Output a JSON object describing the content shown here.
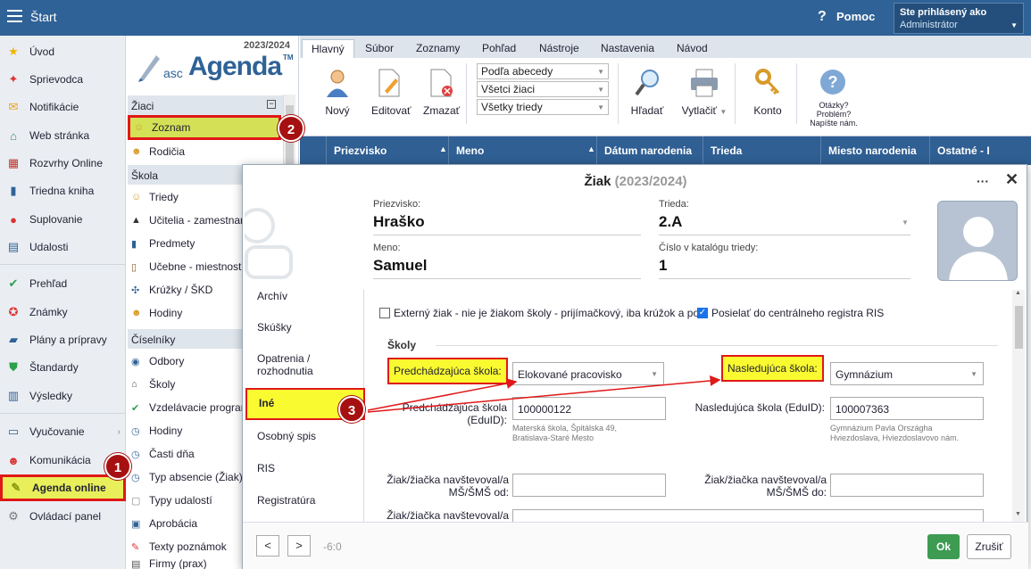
{
  "topbar": {
    "start_label": "Štart",
    "help_label": "Pomoc",
    "logged_in_label": "Ste prihlásený ako",
    "user_role": "Administrátor"
  },
  "leftnav": {
    "items": [
      {
        "label": "Úvod",
        "icon": "star-icon"
      },
      {
        "label": "Sprievodca",
        "icon": "wand-icon"
      },
      {
        "label": "Notifikácie",
        "icon": "envelope-icon"
      },
      {
        "label": "Web stránka",
        "icon": "home-icon"
      },
      {
        "label": "Rozvrhy Online",
        "icon": "calendar-icon"
      },
      {
        "label": "Triedna kniha",
        "icon": "book-icon"
      },
      {
        "label": "Suplovanie",
        "icon": "substitute-icon"
      },
      {
        "label": "Udalosti",
        "icon": "events-icon"
      },
      {
        "label": "Prehľad",
        "icon": "check-icon"
      },
      {
        "label": "Známky",
        "icon": "grades-icon"
      },
      {
        "label": "Plány a prípravy",
        "icon": "briefcase-icon"
      },
      {
        "label": "Štandardy",
        "icon": "shield-icon"
      },
      {
        "label": "Výsledky",
        "icon": "bar-chart-icon"
      },
      {
        "label": "Vyučovanie",
        "icon": "teaching-icon"
      },
      {
        "label": "Komunikácia",
        "icon": "chat-icon"
      },
      {
        "label": "Agenda online",
        "icon": "agenda-icon"
      },
      {
        "label": "Ovládací panel",
        "icon": "gear-icon"
      }
    ]
  },
  "col2": {
    "year": "2023/2024",
    "logo_pre": "asc",
    "logo_main": "Agenda",
    "logo_tm": "TM",
    "sections": [
      {
        "title": "Žiaci",
        "items": [
          "Zoznam",
          "Rodičia"
        ]
      },
      {
        "title": "Škola",
        "items": [
          "Triedy",
          "Učitelia - zamestnanci",
          "Predmety",
          "Učebne - miestnosti",
          "Krúžky / ŠKD",
          "Hodiny"
        ]
      },
      {
        "title": "Číselníky",
        "items": [
          "Odbory",
          "Školy",
          "Vzdelávacie programy",
          "Hodiny",
          "Časti dňa",
          "Typ absencie (Žiak)",
          "Typy udalostí",
          "Aprobácia",
          "Texty poznámok",
          "Firmy (prax)"
        ]
      }
    ]
  },
  "tabs": [
    "Hlavný",
    "Súbor",
    "Zoznamy",
    "Pohľad",
    "Nástroje",
    "Nastavenia",
    "Návod"
  ],
  "toolbar": {
    "new_label": "Nový",
    "edit_label": "Editovať",
    "delete_label": "Zmazať",
    "filters": [
      "Podľa abecedy",
      "Všetci žiaci",
      "Všetky triedy"
    ],
    "search_label": "Hľadať",
    "print_label": "Vytlačiť",
    "account_label": "Konto",
    "help_lines": [
      "Otázky?",
      "Problém?",
      "Napíšte nám."
    ]
  },
  "grid": {
    "columns": [
      "Priezvisko",
      "Meno",
      "Dátum narodenia",
      "Trieda",
      "Miesto narodenia",
      "Ostatné - I"
    ]
  },
  "dialog": {
    "title": "Žiak",
    "year": "(2023/2024)",
    "more": "···",
    "close": "✕",
    "surname_label": "Priezvisko:",
    "surname": "Hraško",
    "class_label": "Trieda:",
    "class_value": "2.A",
    "name_label": "Meno:",
    "name": "Samuel",
    "catalog_label": "Číslo v katalógu triedy:",
    "catalog_value": "1",
    "side_tabs": [
      "Archív",
      "Skúšky",
      "Opatrenia / rozhodnutia",
      "Iné",
      "Osobný spis",
      "RIS",
      "Registratúra"
    ],
    "external_student": "Externý žiak - nie je žiakom školy - prijímačkový, iba krúžok a po",
    "ris_send": "Posielať do centrálneho registra RIS",
    "group_schools": "Školy",
    "prev_school_label": "Predchádzajúca škola:",
    "prev_school_value": "Elokované pracovisko",
    "next_school_label": "Nasledujúca škola:",
    "next_school_value": "Gymnázium",
    "prev_eduid_label_1": "Predchádzajúca škola",
    "prev_eduid_label_2": "(EduID):",
    "prev_eduid_value": "100000122",
    "prev_eduid_note_1": "Materská škola, Špitálska 49,",
    "prev_eduid_note_2": "Bratislava-Staré Mesto",
    "next_eduid_label": "Nasledujúca škola (EduID):",
    "next_eduid_value": "100007363",
    "next_eduid_note_1": "Gymnázium Pavla Országha",
    "next_eduid_note_2": "Hviezdoslava, Hviezdoslavovo nám.",
    "ms_from_label_1": "Žiak/žiačka navštevoval/a",
    "ms_from_label_2": "MŠ/ŠMŠ od:",
    "ms_to_label_1": "Žiak/žiačka navštevoval/a",
    "ms_to_label_2": "MŠ/ŠMŠ do:",
    "ms_other_label_1": "Žiak/žiačka navštevoval/a",
    "footer_pos": "-6:0",
    "ok_label": "Ok",
    "cancel_label": "Zrušiť"
  },
  "callouts": [
    "1",
    "2",
    "3"
  ],
  "colors": {
    "topbar": "#2f6296",
    "highlight_yellow": "#fafa30",
    "highlight_border": "#e01818",
    "badge": "#a61010",
    "ok_green": "#3e9b52"
  }
}
